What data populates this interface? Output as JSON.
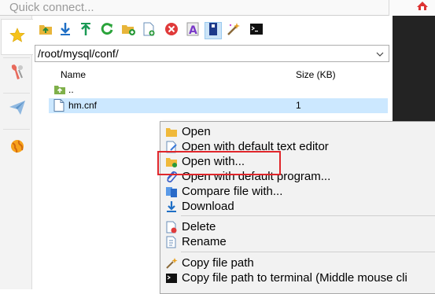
{
  "quick_connect": {
    "placeholder": "Quick connect..."
  },
  "path": {
    "value": "/root/mysql/conf/"
  },
  "table": {
    "columns": [
      "Name",
      "Size (KB)"
    ],
    "rows": [
      {
        "name": "..",
        "size": "",
        "icon": "parent-folder-icon"
      },
      {
        "name": "hm.cnf",
        "size": "1",
        "icon": "file-icon",
        "selected": true
      }
    ]
  },
  "context_menu": {
    "items": [
      {
        "label": "Open",
        "icon": "folder-open-icon"
      },
      {
        "label": "Open with default text editor",
        "icon": "edit-icon"
      },
      {
        "label": "Open with...",
        "icon": "folder-open-with-icon"
      },
      {
        "label": "Open with default program...",
        "icon": "paperclip-icon"
      },
      {
        "label": "Compare file with...",
        "icon": "compare-icon"
      },
      {
        "label": "Download",
        "icon": "download-icon"
      },
      {
        "label": "Delete",
        "icon": "delete-file-icon"
      },
      {
        "label": "Rename",
        "icon": "rename-icon"
      },
      {
        "label": "Copy file path",
        "icon": "magic-wand-icon"
      },
      {
        "label": "Copy file path to terminal (Middle mouse cli",
        "icon": "terminal-icon"
      }
    ]
  },
  "colors": {
    "selection": "#cce8ff",
    "highlight_box": "#e0262b",
    "terminal_bg": "#232323"
  }
}
